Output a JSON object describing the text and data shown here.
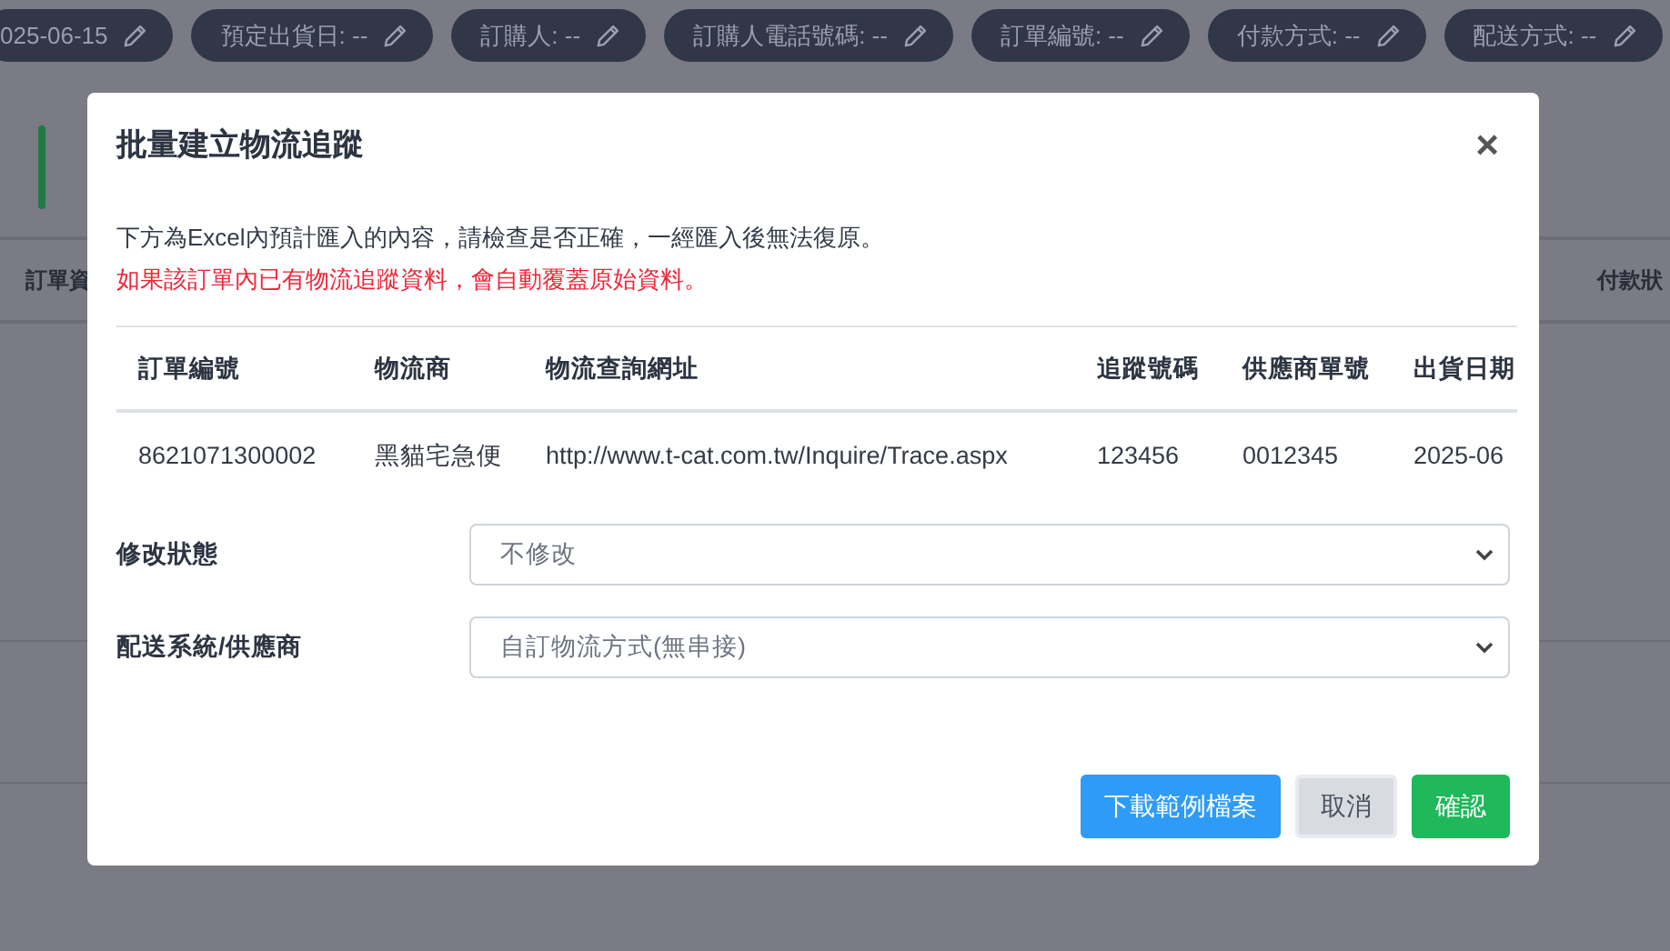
{
  "filter_chips": [
    {
      "label": "025-06-15"
    },
    {
      "label": "預定出貨日: --"
    },
    {
      "label": "訂購人: --"
    },
    {
      "label": "訂購人電話號碼: --"
    },
    {
      "label": "訂單編號: --"
    },
    {
      "label": "付款方式: --"
    },
    {
      "label": "配送方式: --"
    }
  ],
  "background_table": {
    "columns": [
      "訂單資",
      "付款狀"
    ]
  },
  "dialog": {
    "title": "批量建立物流追蹤",
    "close": "×",
    "notice": "下方為Excel內預計匯入的內容，請檢查是否正確，一經匯入後無法復原。",
    "warning": "如果該訂單內已有物流追蹤資料，會自動覆蓋原始資料。",
    "table": {
      "columns": [
        "訂單編號",
        "物流商",
        "物流查詢網址",
        "追蹤號碼",
        "供應商單號",
        "出貨日期"
      ],
      "rows": [
        [
          "8621071300002",
          "黑貓宅急便",
          "http://www.t-cat.com.tw/Inquire/Trace.aspx",
          "123456",
          "0012345",
          "2025-06"
        ]
      ]
    },
    "fields": [
      {
        "label": "修改狀態",
        "value": "不修改"
      },
      {
        "label": "配送系統/供應商",
        "value": "自訂物流方式(無串接)"
      }
    ],
    "buttons": [
      {
        "label": "下載範例檔案",
        "kind": "primary"
      },
      {
        "label": "取消",
        "kind": "secondary"
      },
      {
        "label": "確認",
        "kind": "success"
      }
    ]
  }
}
